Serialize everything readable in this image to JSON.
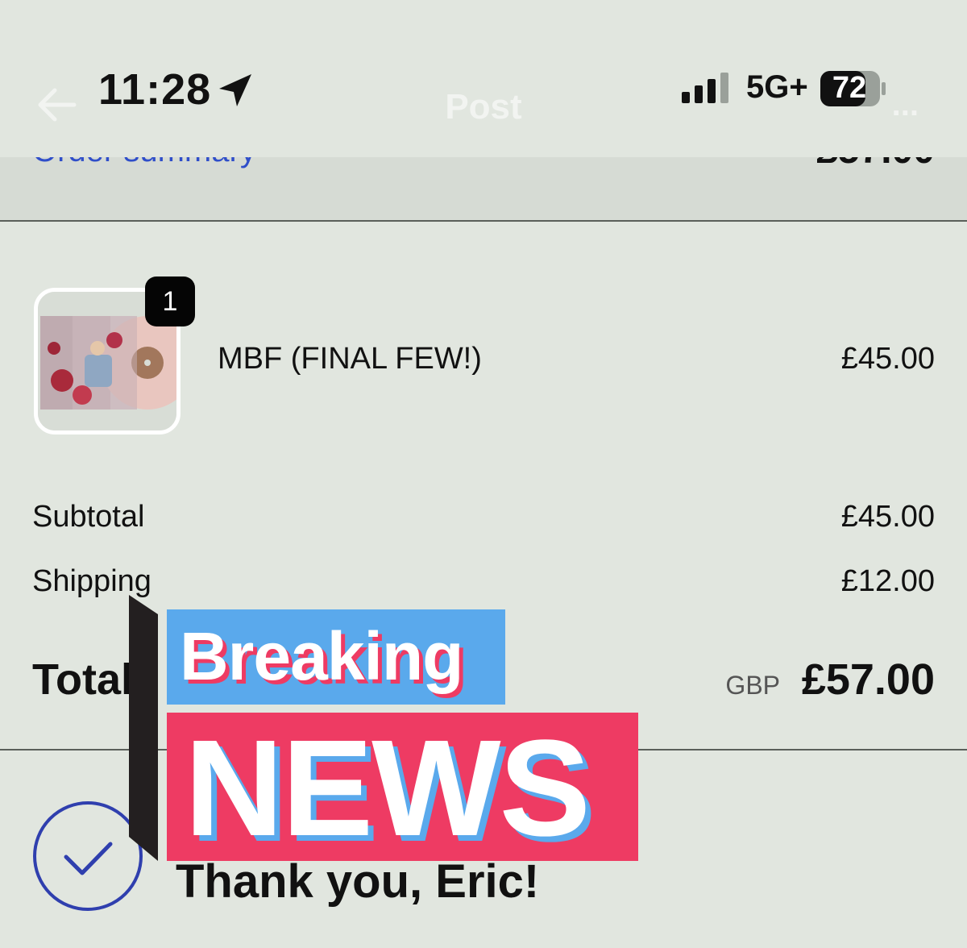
{
  "status_bar": {
    "time": "11:28",
    "network": "5G+",
    "battery": "72"
  },
  "nav": {
    "title": "Post",
    "right": "..."
  },
  "summary": {
    "link": "Order summary",
    "total": "£57.00"
  },
  "product": {
    "quantity": "1",
    "name": "MBF (FINAL FEW!)",
    "price": "£45.00"
  },
  "totals": {
    "subtotal_label": "Subtotal",
    "subtotal_value": "£45.00",
    "shipping_label": "Shipping",
    "shipping_value": "£12.00",
    "total_label": "Total",
    "currency": "GBP",
    "total_value": "£57.00"
  },
  "confirmation": {
    "message": "Thank you, Eric!"
  },
  "overlay": {
    "line1": "Breaking",
    "line2": "NEWS",
    "colors": {
      "blue": "#5aa9ec",
      "pink": "#ee3b63"
    }
  }
}
